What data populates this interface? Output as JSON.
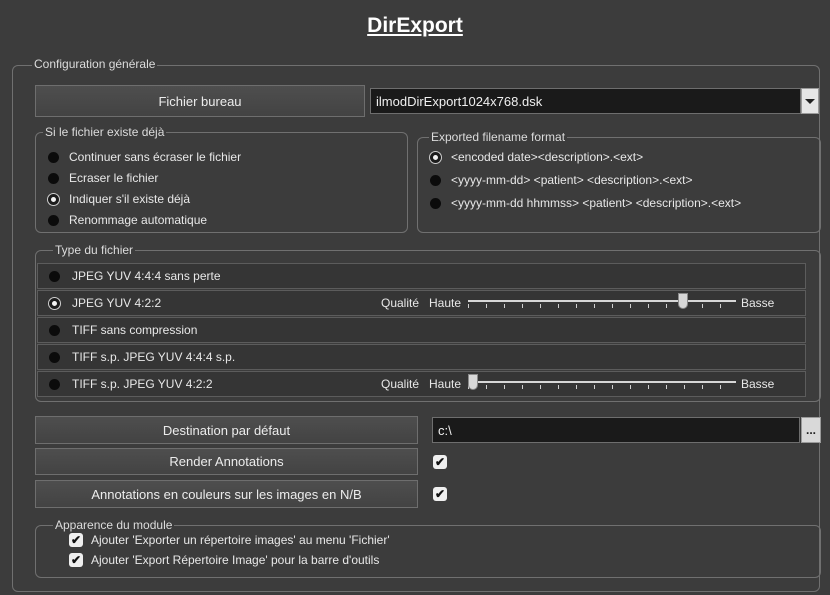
{
  "window": {
    "title": "DirExport"
  },
  "general": {
    "legend": "Configuration générale",
    "desktop_file_button": "Fichier bureau",
    "desktop_file_value": "ilmodDirExport1024x768.dsk"
  },
  "if_exists": {
    "legend": "Si le fichier existe déjà",
    "options": [
      {
        "label": "Continuer sans écraser le fichier",
        "selected": false
      },
      {
        "label": "Ecraser le fichier",
        "selected": false
      },
      {
        "label": "Indiquer s'il existe déjà",
        "selected": true
      },
      {
        "label": "Renommage automatique",
        "selected": false
      }
    ]
  },
  "filename_format": {
    "legend": "Exported filename format",
    "options": [
      {
        "label": "<encoded date><description>.<ext>",
        "selected": true
      },
      {
        "label": "<yyyy-mm-dd> <patient> <description>.<ext>",
        "selected": false
      },
      {
        "label": "<yyyy-mm-dd hhmmss> <patient> <description>.<ext>",
        "selected": false
      }
    ]
  },
  "file_type": {
    "legend": "Type du fichier",
    "options": [
      {
        "label": "JPEG YUV 4:4:4 sans perte",
        "selected": false
      },
      {
        "label": "JPEG YUV 4:2:2",
        "selected": true
      },
      {
        "label": "TIFF sans compression",
        "selected": false
      },
      {
        "label": "TIFF s.p. JPEG YUV 4:4:4 s.p.",
        "selected": false
      },
      {
        "label": "TIFF s.p. JPEG YUV 4:2:2",
        "selected": false
      }
    ],
    "quality_sliders": [
      {
        "label": "Qualité",
        "high": "Haute",
        "low": "Basse",
        "position": 0.8
      },
      {
        "label": "Qualité",
        "high": "Haute",
        "low": "Basse",
        "position": 0.0
      }
    ]
  },
  "destination": {
    "button": "Destination par défaut",
    "value": "c:\\",
    "browse": "..."
  },
  "render_annotations": {
    "button": "Render Annotations",
    "checked": true
  },
  "color_annotations": {
    "button": "Annotations en couleurs sur les images en N/B",
    "checked": true
  },
  "appearance": {
    "legend": "Apparence du module",
    "items": [
      {
        "label": "Ajouter 'Exporter un répertoire images' au menu 'Fichier'",
        "checked": true
      },
      {
        "label": "Ajouter 'Export Répertoire Image' pour la barre d'outils",
        "checked": true
      }
    ]
  },
  "colors": {
    "background": "#3c3c3c",
    "field": "#1a1a1a",
    "text": "#e8e8e8"
  }
}
